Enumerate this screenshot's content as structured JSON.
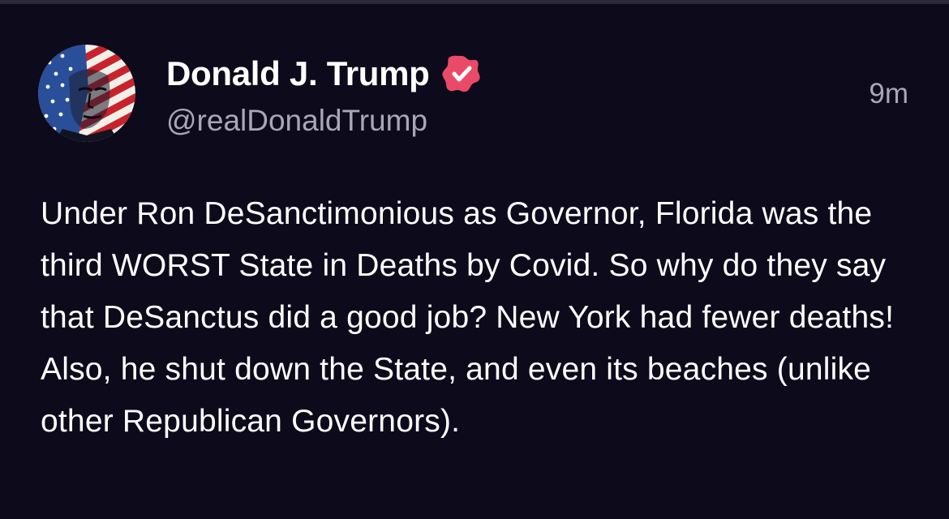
{
  "author": {
    "display_name": "Donald J. Trump",
    "handle": "@realDonaldTrump",
    "avatar_icon": "flag-portrait-avatar",
    "verified_icon": "verified-badge-icon",
    "verified_color": "#e94a68"
  },
  "post": {
    "timestamp": "9m",
    "text": "Under Ron DeSanctimonious as Governor, Florida was the third WORST State in Deaths by Covid. So why do they say that DeSanctus did a good job? New York had fewer deaths! Also, he shut down the State, and even its beaches (unlike other Republican Governors)."
  },
  "colors": {
    "background": "#0d0a1c",
    "primary_text": "#ffffff",
    "secondary_text": "#a9a6b6"
  }
}
